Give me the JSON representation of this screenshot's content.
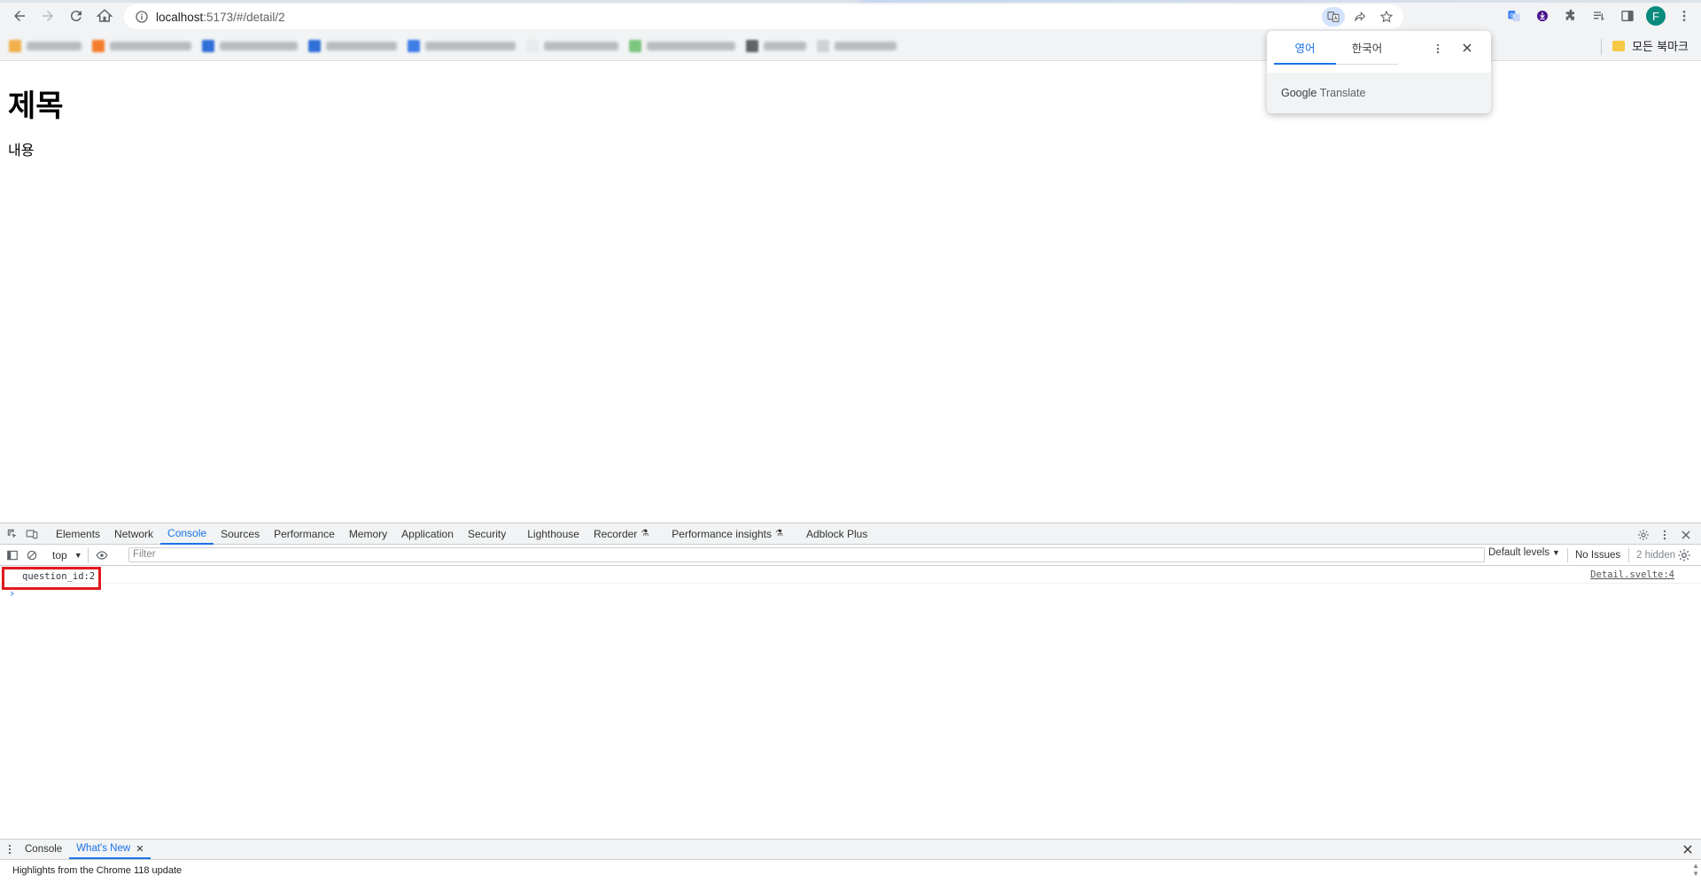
{
  "browser": {
    "url_host": "localhost",
    "url_path": ":5173/#/detail/2",
    "profile_initial": "F",
    "all_bookmarks_label": "모든 북마크",
    "bookmarks": [
      {
        "fav_color": "#f2b04c",
        "text_w": 62
      },
      {
        "fav_color": "#f57c2c",
        "text_w": 92
      },
      {
        "fav_color": "#2f6fd8",
        "text_w": 88
      },
      {
        "fav_color": "#2f6fd8",
        "text_w": 80
      },
      {
        "fav_color": "#3f7ee8",
        "text_w": 102
      },
      {
        "fav_color": "#e8eaed",
        "text_w": 84
      },
      {
        "fav_color": "#7cc67f",
        "text_w": 100
      },
      {
        "fav_color": "#5f6368",
        "text_w": 48
      },
      {
        "fav_color": "#d0d2d6",
        "text_w": 70
      }
    ]
  },
  "page": {
    "title": "제목",
    "content": "내용"
  },
  "translate_popup": {
    "tab_source": "영어",
    "tab_target": "한국어",
    "footer_brand": "Google",
    "footer_product": "Translate"
  },
  "devtools": {
    "tabs": [
      {
        "label": "Elements",
        "active": false,
        "flask": false
      },
      {
        "label": "Network",
        "active": false,
        "flask": false
      },
      {
        "label": "Console",
        "active": true,
        "flask": false
      },
      {
        "label": "Sources",
        "active": false,
        "flask": false
      },
      {
        "label": "Performance",
        "active": false,
        "flask": false
      },
      {
        "label": "Memory",
        "active": false,
        "flask": false
      },
      {
        "label": "Application",
        "active": false,
        "flask": false
      },
      {
        "label": "Security",
        "active": false,
        "flask": false
      },
      {
        "label": "Lighthouse",
        "active": false,
        "flask": false
      },
      {
        "label": "Recorder",
        "active": false,
        "flask": true
      },
      {
        "label": "Performance insights",
        "active": false,
        "flask": true
      },
      {
        "label": "Adblock Plus",
        "active": false,
        "flask": false
      }
    ],
    "context": "top",
    "filter_placeholder": "Filter",
    "levels": "Default levels",
    "issues": "No Issues",
    "hidden": "2 hidden",
    "log": {
      "message": "question_id:2",
      "source": "Detail.svelte:4"
    },
    "drawer": {
      "tab_console": "Console",
      "tab_whats_new": "What's New",
      "headline": "Highlights from the Chrome 118 update"
    }
  },
  "colors": {
    "accent": "#1a73e8",
    "highlight_box": "#e0191e",
    "avatar": "#0b8a7e"
  }
}
